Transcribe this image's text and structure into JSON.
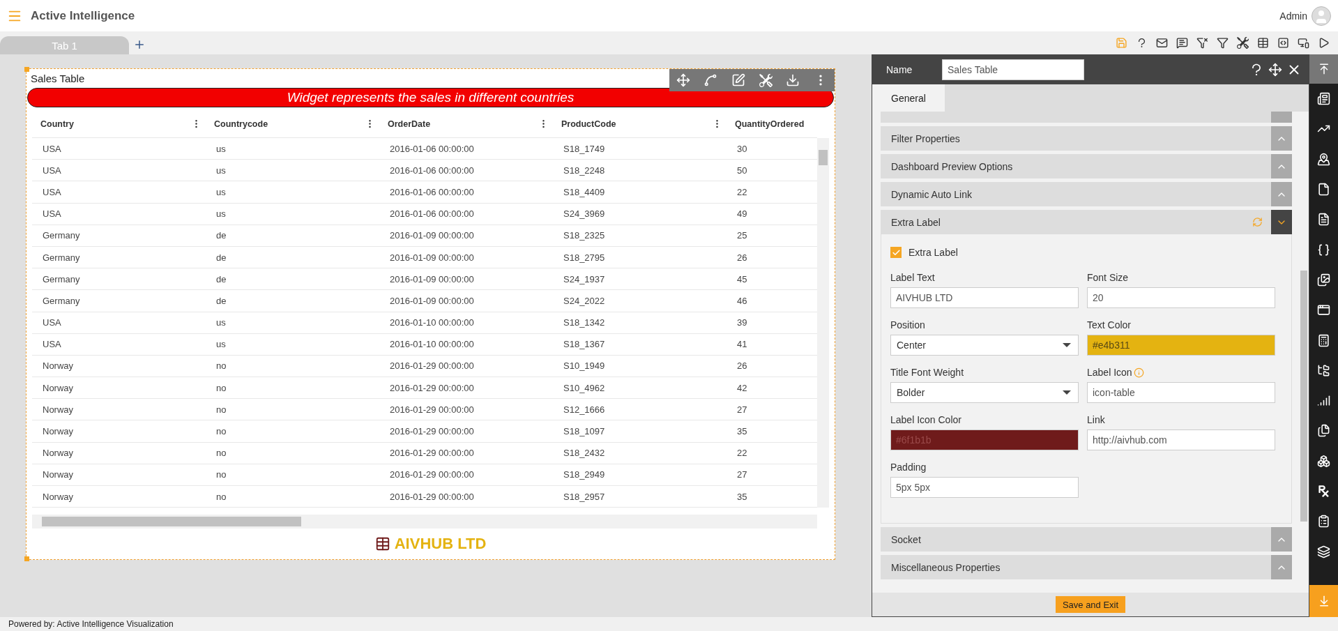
{
  "header": {
    "title": "Active Intelligence",
    "user": "Admin"
  },
  "tabs": [
    {
      "label": "Tab 1",
      "selected": true
    }
  ],
  "widget": {
    "title": "Sales Table",
    "subtitle": "Widget represents the sales in different countries",
    "columns": [
      "Country",
      "Countrycode",
      "OrderDate",
      "ProductCode",
      "QuantityOrdered"
    ],
    "rows": [
      [
        "USA",
        "us",
        "2016-01-06 00:00:00",
        "S18_1749",
        "30"
      ],
      [
        "USA",
        "us",
        "2016-01-06 00:00:00",
        "S18_2248",
        "50"
      ],
      [
        "USA",
        "us",
        "2016-01-06 00:00:00",
        "S18_4409",
        "22"
      ],
      [
        "USA",
        "us",
        "2016-01-06 00:00:00",
        "S24_3969",
        "49"
      ],
      [
        "Germany",
        "de",
        "2016-01-09 00:00:00",
        "S18_2325",
        "25"
      ],
      [
        "Germany",
        "de",
        "2016-01-09 00:00:00",
        "S18_2795",
        "26"
      ],
      [
        "Germany",
        "de",
        "2016-01-09 00:00:00",
        "S24_1937",
        "45"
      ],
      [
        "Germany",
        "de",
        "2016-01-09 00:00:00",
        "S24_2022",
        "46"
      ],
      [
        "USA",
        "us",
        "2016-01-10 00:00:00",
        "S18_1342",
        "39"
      ],
      [
        "USA",
        "us",
        "2016-01-10 00:00:00",
        "S18_1367",
        "41"
      ],
      [
        "Norway",
        "no",
        "2016-01-29 00:00:00",
        "S10_1949",
        "26"
      ],
      [
        "Norway",
        "no",
        "2016-01-29 00:00:00",
        "S10_4962",
        "42"
      ],
      [
        "Norway",
        "no",
        "2016-01-29 00:00:00",
        "S12_1666",
        "27"
      ],
      [
        "Norway",
        "no",
        "2016-01-29 00:00:00",
        "S18_1097",
        "35"
      ],
      [
        "Norway",
        "no",
        "2016-01-29 00:00:00",
        "S18_2432",
        "22"
      ],
      [
        "Norway",
        "no",
        "2016-01-29 00:00:00",
        "S18_2949",
        "27"
      ],
      [
        "Norway",
        "no",
        "2016-01-29 00:00:00",
        "S18_2957",
        "35"
      ]
    ],
    "extra_label": "AIVHUB LTD"
  },
  "panel": {
    "name_label": "Name",
    "name_value": "Sales Table",
    "tabs": [
      {
        "label": "General",
        "selected": true
      }
    ],
    "sections": [
      {
        "title": "Filter Properties",
        "expanded": false,
        "reset": false
      },
      {
        "title": "Dashboard Preview Options",
        "expanded": false,
        "reset": false
      },
      {
        "title": "Dynamic Auto Link",
        "expanded": false,
        "reset": false
      },
      {
        "title": "Extra Label",
        "expanded": true,
        "reset": true
      },
      {
        "title": "Socket",
        "expanded": false,
        "reset": false
      },
      {
        "title": "Miscellaneous Properties",
        "expanded": false,
        "reset": false
      }
    ],
    "extra_label_form": {
      "checkbox": {
        "label": "Extra Label",
        "checked": true
      },
      "fields": [
        {
          "label": "Label Text",
          "value": "AIVHUB LTD",
          "kind": "text",
          "info": false
        },
        {
          "label": "Font Size",
          "value": "20",
          "kind": "text",
          "info": false
        },
        {
          "label": "Position",
          "value": "Center",
          "kind": "select",
          "info": false
        },
        {
          "label": "Text Color",
          "value": "#e4b311",
          "kind": "color",
          "info": false
        },
        {
          "label": "Title Font Weight",
          "value": "Bolder",
          "kind": "select",
          "info": false
        },
        {
          "label": "Label Icon",
          "value": "icon-table",
          "kind": "text",
          "info": true
        },
        {
          "label": "Label Icon Color",
          "value": "#6f1b1b",
          "kind": "color",
          "info": false
        },
        {
          "label": "Link",
          "value": "http://aivhub.com",
          "kind": "text",
          "info": false
        },
        {
          "label": "Padding",
          "value": "5px 5px",
          "kind": "text",
          "info": false
        }
      ]
    },
    "save_button": "Save and Exit"
  },
  "footer": "Powered by: Active Intelligence Visualization"
}
